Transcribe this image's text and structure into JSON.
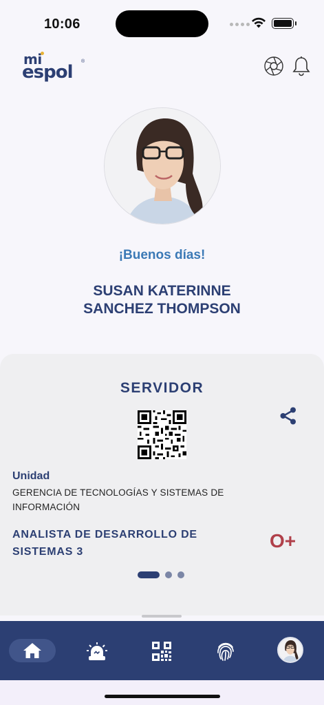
{
  "status_bar": {
    "time": "10:06"
  },
  "header": {
    "logo_top": "mi",
    "logo_bottom": "espol",
    "logo_mark": "®",
    "icons": [
      "aperture-icon",
      "bell-icon"
    ]
  },
  "profile": {
    "greeting": "¡Buenos días!",
    "name_line1": "SUSAN KATERINNE",
    "name_line2": "SANCHEZ THOMPSON"
  },
  "card": {
    "title": "SERVIDOR",
    "unit_label": "Unidad",
    "unit_value": "GERENCIA DE TECNOLOGÍAS Y SISTEMAS DE INFORMACIÓN",
    "role": "ANALISTA DE DESARROLLO DE SISTEMAS 3",
    "blood_type": "O+",
    "pager": {
      "pages": 3,
      "current": 1
    }
  },
  "bottom_nav": {
    "items": [
      "home-icon",
      "alarm-icon",
      "qr-code-icon",
      "fingerprint-icon",
      "profile-avatar"
    ],
    "active": "home-icon"
  },
  "colors": {
    "brand": "#2c3f73",
    "greeting": "#3b79b6",
    "blood": "#b0404a",
    "logo_dot": "#e8b233"
  }
}
